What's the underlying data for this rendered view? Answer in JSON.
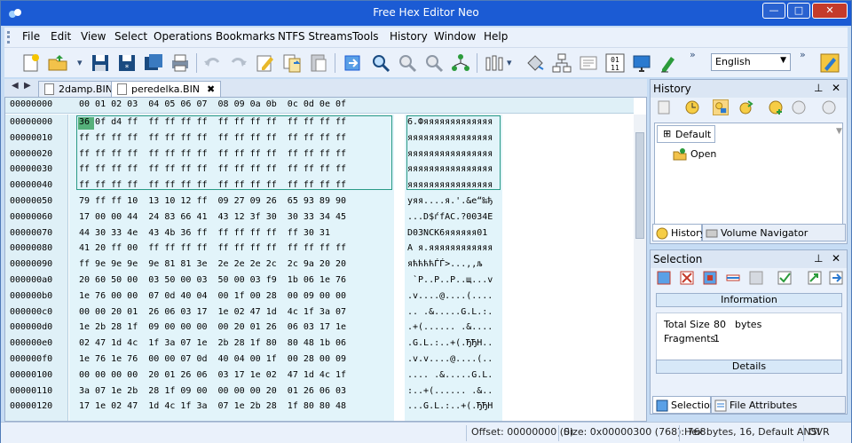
{
  "window": {
    "title": "Free Hex Editor Neo"
  },
  "menu": [
    "File",
    "Edit",
    "View",
    "Select",
    "Operations",
    "Bookmarks",
    "NTFS Streams",
    "Tools",
    "History",
    "Window",
    "Help"
  ],
  "toolbar": {
    "language": "English",
    "more": "»"
  },
  "tabs": [
    {
      "label": "2damp.BIN"
    },
    {
      "label": "peredelka.BIN",
      "close": "✖"
    }
  ],
  "hex": {
    "header_offset": "00000000",
    "header_cols": "00 01 02 03  04 05 06 07  08 09 0a 0b  0c 0d 0e 0f",
    "rows": [
      {
        "offset": "00000000",
        "hex": "36 0f d4 ff  ff ff ff ff  ff ff ff ff  ff ff ff ff",
        "text": "6.Фяяяяяяяяяяяяя"
      },
      {
        "offset": "00000010",
        "hex": "ff ff ff ff  ff ff ff ff  ff ff ff ff  ff ff ff ff",
        "text": "яяяяяяяяяяяяяяяя"
      },
      {
        "offset": "00000020",
        "hex": "ff ff ff ff  ff ff ff ff  ff ff ff ff  ff ff ff ff",
        "text": "яяяяяяяяяяяяяяяя"
      },
      {
        "offset": "00000030",
        "hex": "ff ff ff ff  ff ff ff ff  ff ff ff ff  ff ff ff ff",
        "text": "яяяяяяяяяяяяяяяя"
      },
      {
        "offset": "00000040",
        "hex": "ff ff ff ff  ff ff ff ff  ff ff ff ff  ff ff ff ff",
        "text": "яяяяяяяяяяяяяяяя"
      },
      {
        "offset": "00000050",
        "hex": "79 ff ff 10  13 10 12 ff  09 27 09 26  65 93 89 90",
        "text": "уяя....я.'.&e“‰ђ"
      },
      {
        "offset": "00000060",
        "hex": "17 00 00 44  24 83 66 41  43 12 3f 30  30 33 34 45",
        "text": "...D$ѓfAC.?0034E"
      },
      {
        "offset": "00000070",
        "hex": "44 30 33 4e  43 4b 36 ff  ff ff ff ff  ff 30 31",
        "text": "D03NCK6яяяяяя01"
      },
      {
        "offset": "00000080",
        "hex": "41 20 ff 00  ff ff ff ff  ff ff ff ff  ff ff ff ff",
        "text": "A я.яяяяяяяяяяяя"
      },
      {
        "offset": "00000090",
        "hex": "ff 9e 9e 9e  9e 81 81 3e  2e 2e 2e 2c  2c 9a 20 20",
        "text": "яћћћћЃЃ>...,,љ  "
      },
      {
        "offset": "000000a0",
        "hex": "20 60 50 00  03 50 00 03  50 00 03 f9  1b 06 1e 76",
        "text": " `P..P..P..щ...v"
      },
      {
        "offset": "000000b0",
        "hex": "1e 76 00 00  07 0d 40 04  00 1f 00 28  00 09 00 00",
        "text": ".v....@....(...."
      },
      {
        "offset": "000000c0",
        "hex": "00 00 20 01  26 06 03 17  1e 02 47 1d  4c 1f 3a 07",
        "text": ".. .&.....G.L.:."
      },
      {
        "offset": "000000d0",
        "hex": "1e 2b 28 1f  09 00 00 00  00 20 01 26  06 03 17 1e",
        "text": ".+(...... .&...."
      },
      {
        "offset": "000000e0",
        "hex": "02 47 1d 4c  1f 3a 07 1e  2b 28 1f 80  80 48 1b 06",
        "text": ".G.L.:..+(.ЂЂH.."
      },
      {
        "offset": "000000f0",
        "hex": "1e 76 1e 76  00 00 07 0d  40 04 00 1f  00 28 00 09",
        "text": ".v.v....@....(.."
      },
      {
        "offset": "00000100",
        "hex": "00 00 00 00  20 01 26 06  03 17 1e 02  47 1d 4c 1f",
        "text": ".... .&.....G.L."
      },
      {
        "offset": "00000110",
        "hex": "3a 07 1e 2b  28 1f 09 00  00 00 00 20  01 26 06 03",
        "text": ":..+(...... .&.."
      },
      {
        "offset": "00000120",
        "hex": "17 1e 02 47  1d 4c 1f 3a  07 1e 2b 28  1f 80 80 48",
        "text": "...G.L.:..+(.ЂЂH"
      }
    ]
  },
  "history_panel": {
    "title": "History",
    "tab": "Default",
    "item": "Open",
    "bottom_tabs": [
      "History",
      "Volume Navigator"
    ]
  },
  "selection_panel": {
    "title": "Selection",
    "information_label": "Information",
    "total_size_label": "Total Size",
    "total_size_value": "80",
    "total_size_unit": "bytes",
    "fragments_label": "Fragments",
    "fragments_value": "1",
    "details_label": "Details",
    "bottom_tabs": [
      "Selection",
      "File Attributes"
    ]
  },
  "status": {
    "offset": "Offset: 00000000 (0)",
    "size": "Size: 0x00000300 (768): 768",
    "mode": "Hex bytes, 16, Default ANSI",
    "ovr": "OVR"
  },
  "colors": {
    "titlebar": "#1b5bd4",
    "selection_border": "#2a9a86",
    "cursor": "#55b07a",
    "hex_bg": "#e2f4fa"
  }
}
